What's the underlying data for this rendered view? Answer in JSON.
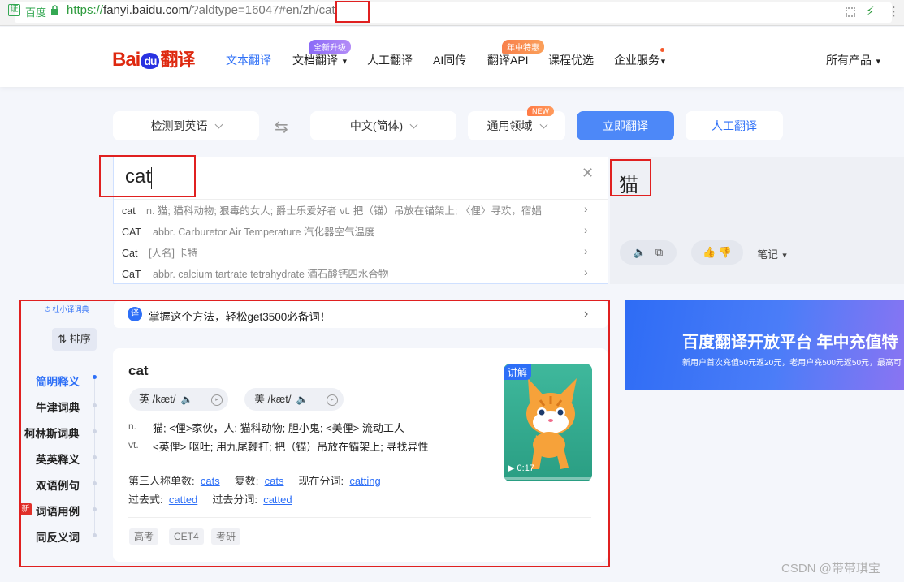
{
  "browser": {
    "site_label": "百度",
    "url_scheme": "https://",
    "url_host": "fanyi.baidu.com",
    "url_path": "/?aldtype=16047#en/zh",
    "url_hl": "/cat",
    "cert_icon": "证"
  },
  "header": {
    "logo_left": "Bai",
    "logo_du": "du",
    "logo_right": "翻译",
    "nav": [
      {
        "label": "文本翻译"
      },
      {
        "label": "文档翻译",
        "badge": "全新升级"
      },
      {
        "label": "人工翻译"
      },
      {
        "label": "AI同传"
      },
      {
        "label": "翻译API",
        "badge": "年中特惠"
      },
      {
        "label": "课程优选"
      },
      {
        "label": "企业服务"
      }
    ],
    "products": "所有产品"
  },
  "controls": {
    "source_lang": "检测到英语",
    "target_lang": "中文(简体)",
    "domain": "通用领域",
    "domain_badge": "NEW",
    "translate_btn": "立即翻译",
    "human_btn": "人工翻译"
  },
  "input": {
    "value": "cat",
    "suggestions": [
      {
        "word": "cat",
        "def": "n. 猫; 猫科动物; 狠毒的女人; 爵士乐爱好者 vt. 把（锚）吊放在锚架上; 〈俚〉寻欢，宿娼"
      },
      {
        "word": "CAT",
        "def": "abbr. Carburetor Air Temperature 汽化器空气温度"
      },
      {
        "word": "Cat",
        "def": "[人名] 卡特"
      },
      {
        "word": "CaT",
        "def": "abbr. calcium tartrate tetrahydrate 酒石酸钙四水合物"
      }
    ]
  },
  "output": {
    "value": "猫",
    "notes": "笔记"
  },
  "dict": {
    "source": "杜小译词典",
    "sort": "排序",
    "sidebar": [
      {
        "label": "简明释义",
        "active": true
      },
      {
        "label": "牛津词典"
      },
      {
        "label": "柯林斯词典"
      },
      {
        "label": "英英释义"
      },
      {
        "label": "双语例句"
      },
      {
        "label": "词语用例",
        "new": "新"
      },
      {
        "label": "同反义词"
      }
    ],
    "tip": "掌握这个方法，轻松get3500必备词！",
    "tip_icon": "译",
    "word": "cat",
    "phonetics": [
      {
        "label": "英 /kæt/"
      },
      {
        "label": "美 /kæt/"
      }
    ],
    "definitions": [
      {
        "pos": "n.",
        "text": "猫;  <俚>家伙，人;  猫科动物;  胆小鬼;  <美俚> 流动工人"
      },
      {
        "pos": "vt.",
        "text": "<英俚> 呕吐;  用九尾鞭打;  把（锚）吊放在锚架上;  寻找异性"
      }
    ],
    "forms": {
      "third_label": "第三人称单数:",
      "third": "cats",
      "plural_label": "复数:",
      "plural": "cats",
      "present_label": "现在分词:",
      "present": "catting",
      "past_label": "过去式:",
      "past": "catted",
      "pp_label": "过去分词:",
      "pp": "catted"
    },
    "tags": [
      "高考",
      "CET4",
      "考研"
    ],
    "video": {
      "label": "讲解",
      "time": "0:17"
    }
  },
  "ad": {
    "title": "百度翻译开放平台 年中充值特",
    "subtitle": "新用户首次充值50元返20元，老用户充500元返50元，最高可"
  },
  "watermark": "CSDN @带带琪宝",
  "colors": {
    "accent": "#2d6ff7",
    "highlight": "#e02020",
    "brand_red": "#de2910"
  }
}
